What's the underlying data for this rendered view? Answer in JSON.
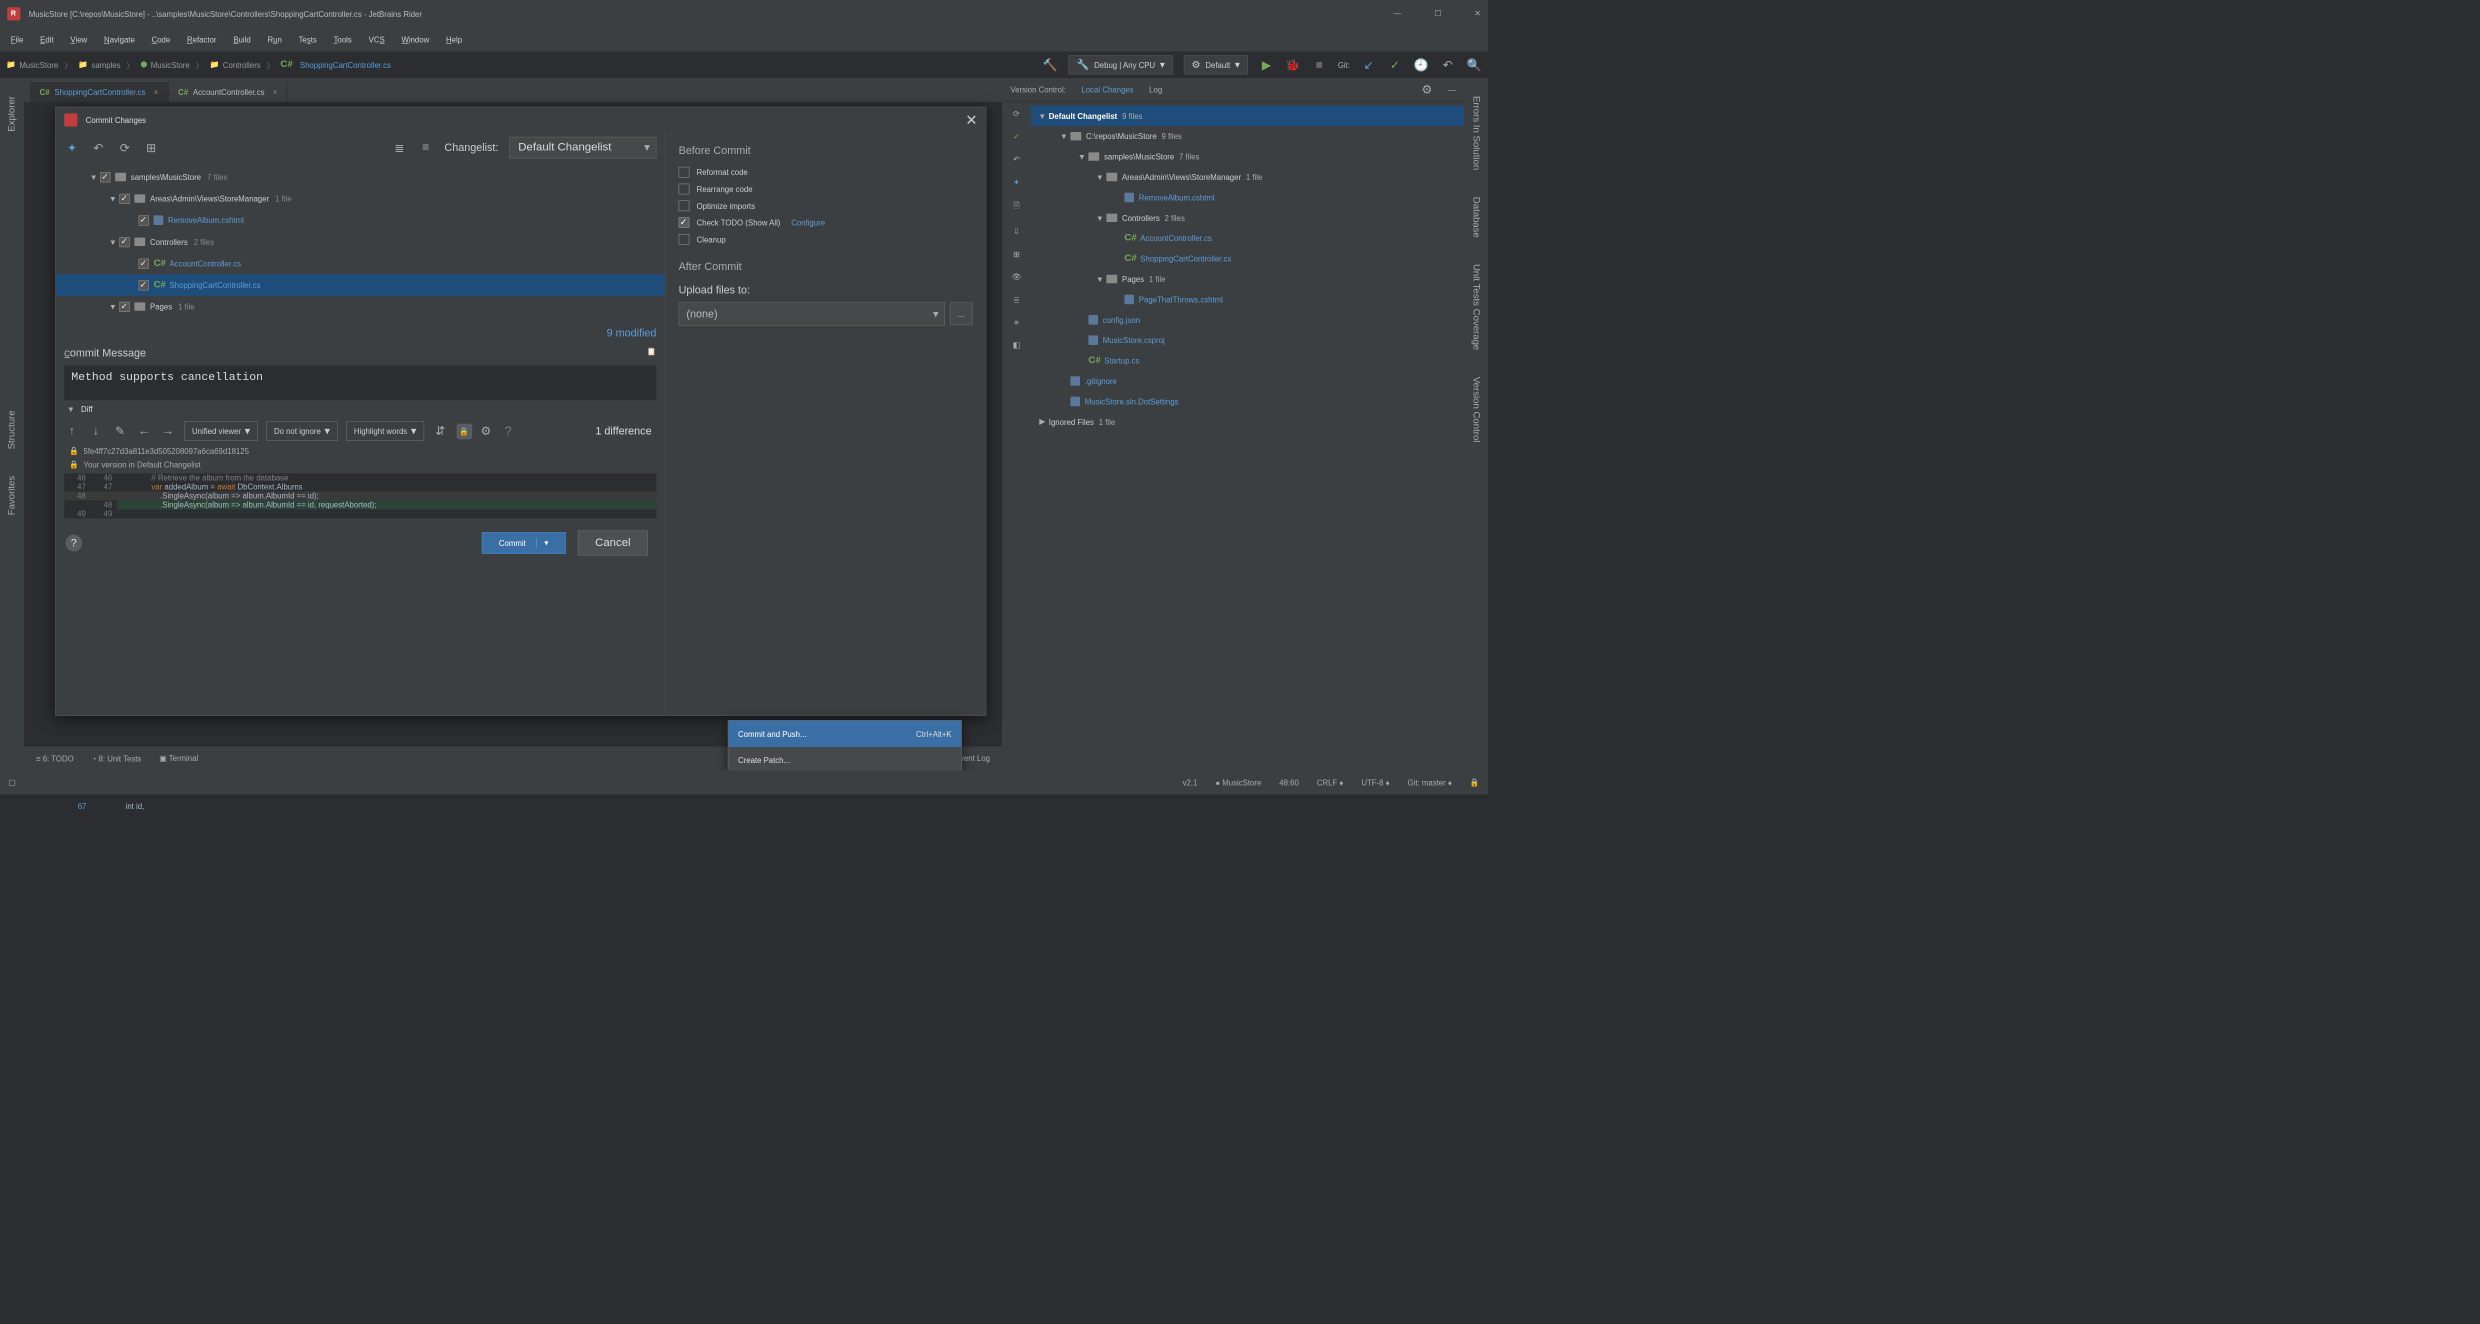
{
  "window": {
    "title": "MusicStore [C:\\repos\\MusicStore] - ..\\samples\\MusicStore\\Controllers\\ShoppingCartController.cs - JetBrains Rider"
  },
  "menu": [
    "File",
    "Edit",
    "View",
    "Navigate",
    "Code",
    "Refactor",
    "Build",
    "Run",
    "Tests",
    "Tools",
    "VCS",
    "Window",
    "Help"
  ],
  "breadcrumb": [
    {
      "icon": "solution",
      "text": "MusicStore"
    },
    {
      "icon": "folder",
      "text": "samples"
    },
    {
      "icon": "project",
      "text": "MusicStore"
    },
    {
      "icon": "folder",
      "text": "Controllers"
    },
    {
      "icon": "cs",
      "text": "ShoppingCartController.cs",
      "hl": true
    }
  ],
  "run_config": "Debug | Any CPU",
  "run_target": "Default",
  "git_label": "Git:",
  "tabs": [
    {
      "label": "ShoppingCartController.cs",
      "active": true
    },
    {
      "label": "AccountController.cs",
      "active": false
    }
  ],
  "dialog": {
    "title": "Commit Changes",
    "changelist_label": "Changelist:",
    "changelist_value": "Default Changelist",
    "tree": [
      {
        "indent": 1,
        "dir": true,
        "name": "samples\\MusicStore",
        "count": "7 files",
        "checked": true
      },
      {
        "indent": 2,
        "dir": true,
        "name": "Areas\\Admin\\Views\\StoreManager",
        "count": "1 file",
        "checked": true
      },
      {
        "indent": 3,
        "file": true,
        "icon": "page",
        "name": "RemoveAlbum.cshtml",
        "checked": true
      },
      {
        "indent": 2,
        "dir": true,
        "name": "Controllers",
        "count": "2 files",
        "checked": true
      },
      {
        "indent": 3,
        "file": true,
        "icon": "cs",
        "name": "AccountController.cs",
        "checked": true
      },
      {
        "indent": 3,
        "file": true,
        "icon": "cs",
        "name": "ShoppingCartController.cs",
        "checked": true,
        "selected": true
      },
      {
        "indent": 2,
        "dir": true,
        "name": "Pages",
        "count": "1 file",
        "checked": true
      }
    ],
    "modified_count": "9 modified",
    "commit_msg_label": "Commit Message",
    "commit_msg": "Method supports cancellation",
    "diff_label": "Diff",
    "diff_toolbar": {
      "viewer": "Unified viewer",
      "ignore": "Do not ignore",
      "highlight": "Highlight words"
    },
    "diff_count": "1 difference",
    "diff_hash": "5fe4ff7c27d3a811e3d505208097a6ca69d18125",
    "diff_version": "Your version in Default Changelist",
    "code": [
      {
        "l": "46",
        "r": "46",
        "t": "            // Retrieve the album from the database",
        "cls": "cm"
      },
      {
        "l": "47",
        "r": "47",
        "t": "            var addedAlbum = await DbContext.Albums"
      },
      {
        "l": "48",
        "r": "",
        "t": "                .SingleAsync(album => album.AlbumId == id);",
        "kind": "del"
      },
      {
        "l": "",
        "r": "48",
        "t": "                .SingleAsync(album => album.AlbumId == id, requestAborted);",
        "kind": "add"
      },
      {
        "l": "49",
        "r": "49",
        "t": ""
      }
    ],
    "extra_code_line": {
      "n": "67",
      "t": "            int id,"
    },
    "buttons": {
      "commit": "Commit",
      "cancel": "Cancel"
    },
    "before_commit_label": "Before Commit",
    "before_commit": [
      {
        "label": "Reformat code",
        "on": false
      },
      {
        "label": "Rearrange code",
        "on": false
      },
      {
        "label": "Optimize imports",
        "on": false
      },
      {
        "label": "Check TODO (Show All)",
        "on": true,
        "link": "Configure"
      },
      {
        "label": "Cleanup",
        "on": false
      }
    ],
    "after_commit_label": "After Commit",
    "upload_label": "Upload files to:",
    "upload_value": "(none)"
  },
  "ctx_menu": [
    {
      "label": "Commit and Push...",
      "shortcut": "Ctrl+Alt+K",
      "sel": true
    },
    {
      "label": "Create Patch...",
      "sel": false
    }
  ],
  "vc": {
    "header": "Version Control:",
    "tabs": [
      "Local Changes",
      "Log"
    ],
    "active_tab": 0,
    "root": {
      "label": "Default Changelist",
      "count": "9 files"
    },
    "nodes": [
      {
        "indent": 1,
        "dir": true,
        "name": "C:\\repos\\MusicStore",
        "count": "9 files"
      },
      {
        "indent": 2,
        "dir": true,
        "name": "samples\\MusicStore",
        "count": "7 files"
      },
      {
        "indent": 3,
        "dir": true,
        "name": "Areas\\Admin\\Views\\StoreManager",
        "count": "1 file"
      },
      {
        "indent": 4,
        "file": true,
        "icon": "page",
        "name": "RemoveAlbum.cshtml"
      },
      {
        "indent": 3,
        "dir": true,
        "name": "Controllers",
        "count": "2 files"
      },
      {
        "indent": 4,
        "file": true,
        "icon": "cs",
        "name": "AccountController.cs"
      },
      {
        "indent": 4,
        "file": true,
        "icon": "cs",
        "name": "ShoppingCartController.cs"
      },
      {
        "indent": 3,
        "dir": true,
        "name": "Pages",
        "count": "1 file"
      },
      {
        "indent": 4,
        "file": true,
        "icon": "page",
        "name": "PageThatThrows.cshtml"
      },
      {
        "indent": 2,
        "file": true,
        "icon": "json",
        "name": "config.json"
      },
      {
        "indent": 2,
        "file": true,
        "icon": "proj",
        "name": "MusicStore.csproj"
      },
      {
        "indent": 2,
        "file": true,
        "icon": "cs",
        "name": "Startup.cs"
      },
      {
        "indent": 1,
        "file": true,
        "icon": "txt",
        "name": ".gitignore"
      },
      {
        "indent": 1,
        "file": true,
        "icon": "txt",
        "name": "MusicStore.sln.DotSettings"
      }
    ],
    "ignored": {
      "label": "Ignored Files",
      "count": "1 file"
    }
  },
  "left_rails": [
    "Explorer",
    "Structure",
    "Favorites"
  ],
  "right_rails": [
    "Errors In Solution",
    "Database",
    "Unit Tests Coverage",
    "Version Control"
  ],
  "bottom_tools": {
    "todo": "6: TODO",
    "unit": "8: Unit Tests",
    "terminal": "Terminal",
    "eventlog": "Event Log"
  },
  "status": {
    "ver": "v2.1",
    "project": "MusicStore",
    "pos": "48:60",
    "le": "CRLF",
    "enc": "UTF-8",
    "branch": "Git: master"
  }
}
